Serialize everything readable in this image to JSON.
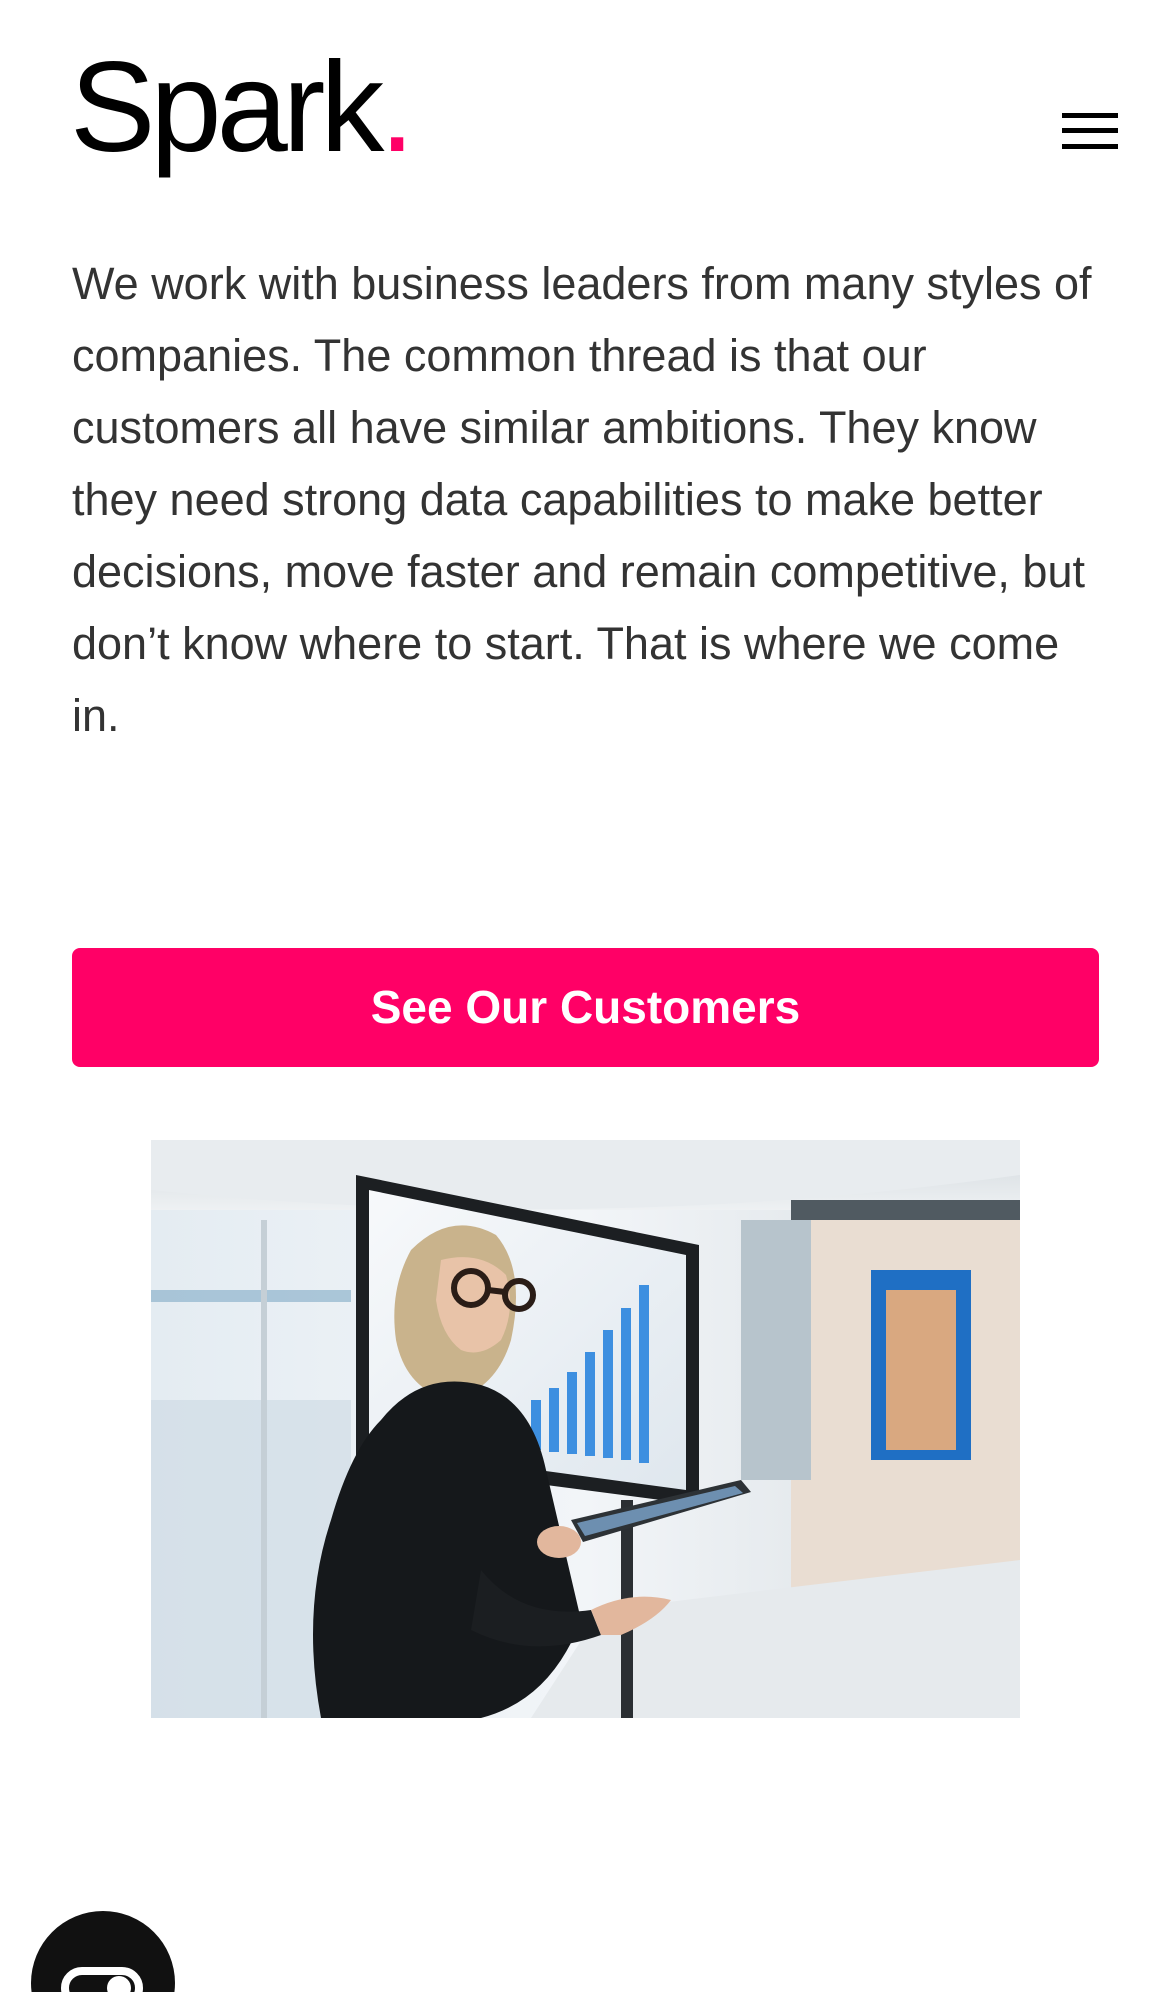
{
  "header": {
    "logo_text": "Spark",
    "logo_dot": ".",
    "menu_icon": "hamburger-menu-icon"
  },
  "intro": {
    "text": "We work with business leaders from many styles of companies. The common thread is that our customers all have similar ambitions. They know they need strong data capabilities to make better decisions, move faster and remain competitive, but don’t know where to start. That is where we come in."
  },
  "cta": {
    "label": "See Our Customers"
  },
  "image": {
    "icon": "photo-woman-presenting-chart"
  },
  "widget": {
    "icon": "chat-widget-icon"
  },
  "colors": {
    "accent": "#ff0066",
    "text": "#333333",
    "logo": "#000000"
  }
}
